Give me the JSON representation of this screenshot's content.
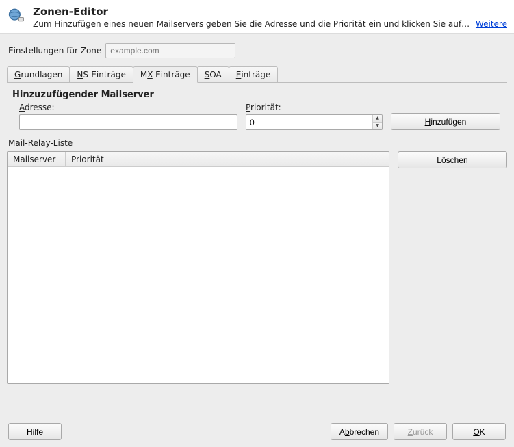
{
  "header": {
    "title": "Zonen-Editor",
    "subtitle": "Zum Hinzufügen eines neuen Mailservers geben Sie die Adresse und die Priorität ein und klicken Sie auf Hinz...",
    "more_link": "Weitere"
  },
  "zone": {
    "label": "Einstellungen für Zone",
    "placeholder": "example.com",
    "value": ""
  },
  "tabs": {
    "t0": {
      "pre": "",
      "u": "G",
      "post": "rundlagen"
    },
    "t1": {
      "pre": "",
      "u": "N",
      "post": "S-Einträge"
    },
    "t2": {
      "pre": "M",
      "u": "X",
      "post": "-Einträge"
    },
    "t3": {
      "pre": "",
      "u": "S",
      "post": "OA"
    },
    "t4": {
      "pre": "",
      "u": "E",
      "post": "inträge"
    }
  },
  "form": {
    "group_title": "Hinzuzufügender Mailserver",
    "address_label_pre": "",
    "address_label_u": "A",
    "address_label_post": "dresse:",
    "address_value": "",
    "priority_label_pre": "",
    "priority_label_u": "P",
    "priority_label_post": "riorität:",
    "priority_value": "0",
    "add_button_pre": "",
    "add_button_u": "H",
    "add_button_post": "inzufügen"
  },
  "relay": {
    "title": "Mail-Relay-Liste",
    "col_mailserver": "Mailserver",
    "col_priority": "Priorität",
    "delete_pre": "",
    "delete_u": "L",
    "delete_post": "öschen",
    "rows": []
  },
  "footer": {
    "help": "Hilfe",
    "cancel_pre": "A",
    "cancel_u": "b",
    "cancel_post": "brechen",
    "back_pre": "",
    "back_u": "Z",
    "back_post": "urück",
    "ok_pre": "",
    "ok_u": "O",
    "ok_post": "K"
  }
}
